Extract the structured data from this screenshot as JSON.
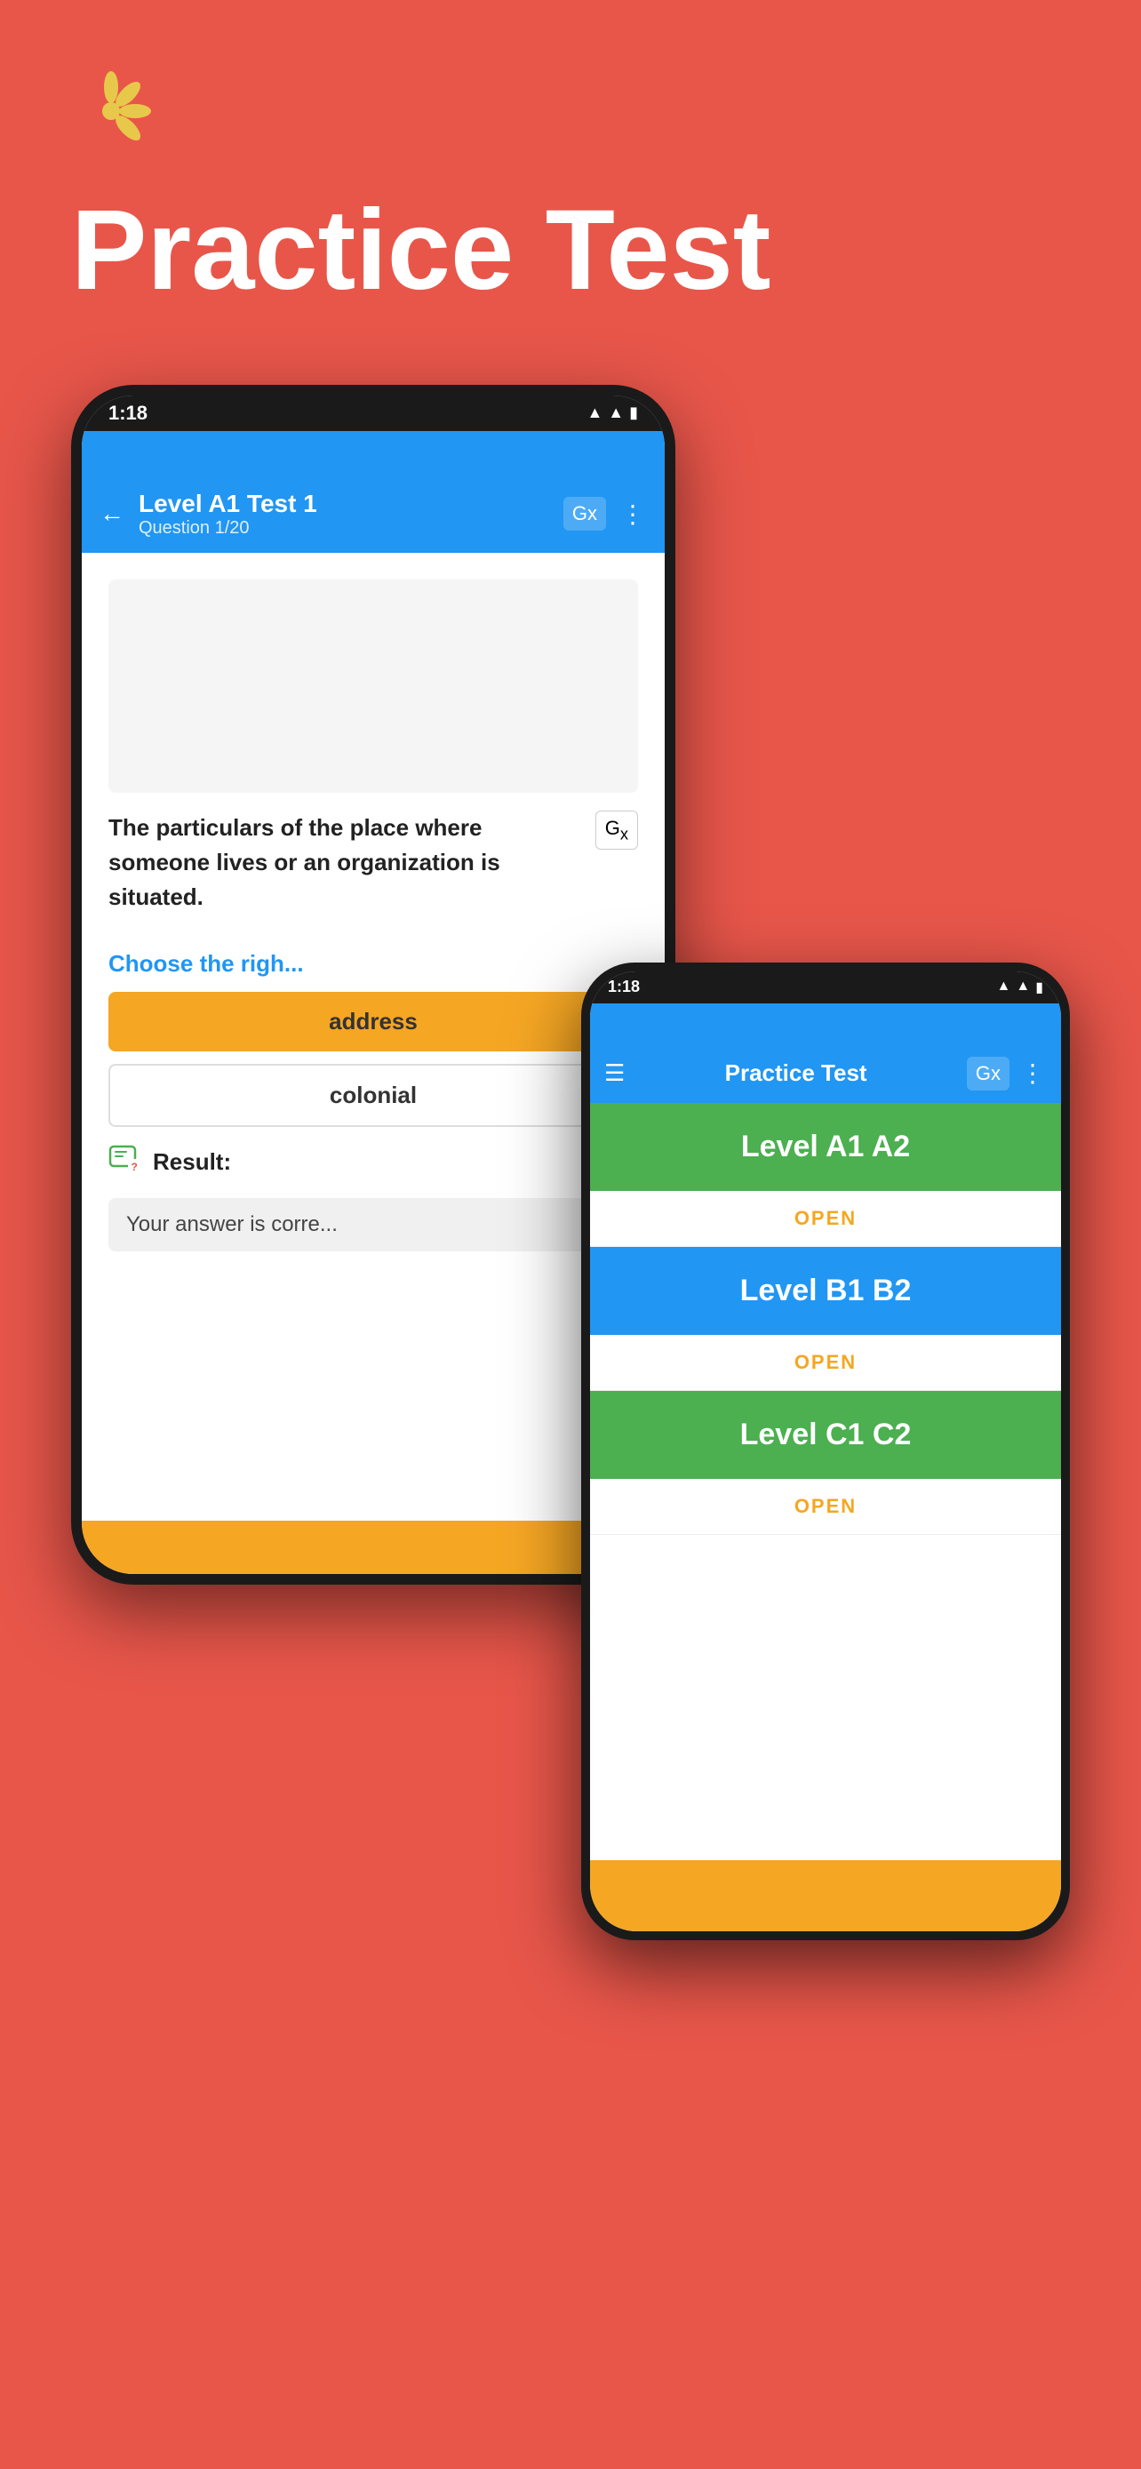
{
  "page": {
    "background_color": "#E8564A",
    "title": "Practice Test",
    "flower_icon": "✳",
    "flower_color": "#E8C84A"
  },
  "phone_main": {
    "status_bar": {
      "time": "1:18",
      "wifi_icon": "wifi",
      "signal_icon": "signal",
      "battery_icon": "battery"
    },
    "header": {
      "back_label": "←",
      "title": "Level A1 Test 1",
      "subtitle": "Question 1/20",
      "translate_icon": "Gx",
      "more_icon": "⋮"
    },
    "question": {
      "text": "The particulars of the place where someone lives or an organization is situated.",
      "translate_icon_label": "Gx"
    },
    "choose_label": "Choose the righ",
    "answers": [
      {
        "text": "address",
        "style": "gold"
      },
      {
        "text": "colonial",
        "style": "outlined"
      }
    ],
    "result": {
      "icon": "💬❓",
      "label": "Result:",
      "message": "Your answer is corre"
    }
  },
  "phone_second": {
    "status_bar": {
      "time": "1:18",
      "wifi_icon": "wifi",
      "signal_icon": "signal",
      "battery_icon": "battery"
    },
    "header": {
      "hamburger_label": "☰",
      "title": "Practice Test",
      "translate_icon": "Gx",
      "more_icon": "⋮"
    },
    "levels": [
      {
        "name": "Level A1 A2",
        "style": "green",
        "open_label": "OPEN"
      },
      {
        "name": "Level B1 B2",
        "style": "blue",
        "open_label": "OPEN"
      },
      {
        "name": "Level C1 C2",
        "style": "green",
        "open_label": "OPEN"
      }
    ]
  }
}
